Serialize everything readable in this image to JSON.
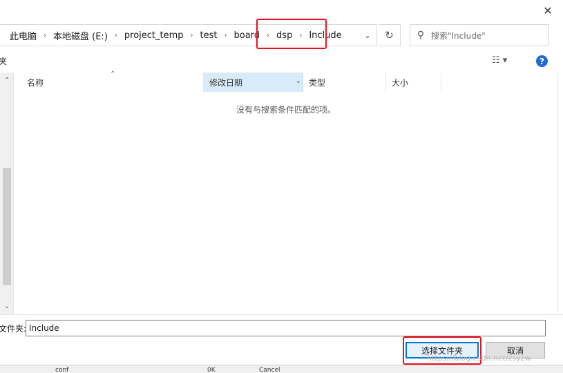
{
  "window": {
    "close_glyph": "✕"
  },
  "address_bar": {
    "crumbs": [
      "此电脑",
      "本地磁盘 (E:)",
      "project_temp",
      "test",
      "board",
      "dsp",
      "Include"
    ],
    "separator_glyph": "›",
    "dropdown_glyph": "⌄",
    "refresh_glyph": "↻"
  },
  "search": {
    "placeholder": "搜索\"Include\"",
    "icon": "search-icon",
    "icon_glyph": "⚲"
  },
  "toolbar": {
    "left_label": "夹",
    "view_glyph": "☷ ▾",
    "help_glyph": "?"
  },
  "nav": {
    "up_glyph": "⌃",
    "down_glyph": "⌄"
  },
  "columns": {
    "name": "名称",
    "date": "修改日期",
    "type": "类型",
    "size": "大小",
    "sort_glyph": "⌃",
    "filter_glyph": "⌄"
  },
  "empty_message": "没有与搜索条件匹配的项。",
  "filename": {
    "label": "文件夹:",
    "value": "Include"
  },
  "buttons": {
    "select_folder": "选择文件夹",
    "cancel": "取消"
  },
  "watermark": "https://blog.csdn.net/zsyzw",
  "behind_window": {
    "cell1": "conf",
    "cell2": "0K",
    "cell3": "Cancel"
  },
  "colors": {
    "highlight": "#e81123",
    "accent": "#0078d7",
    "sorted_column": "#d9ebf9"
  }
}
